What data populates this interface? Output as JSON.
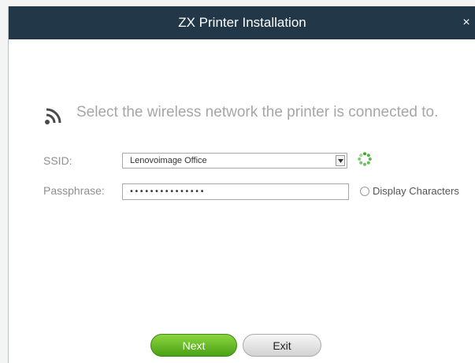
{
  "window": {
    "title": "ZX Printer Installation",
    "close_symbol": "×"
  },
  "content": {
    "heading": "Select the wireless network the printer is connected to.",
    "heading_icon": "wifi-icon",
    "ssid": {
      "label": "SSID:",
      "value": "Lenovoimage Office"
    },
    "passphrase": {
      "label": "Passphrase:",
      "value": "•••••••••••••••"
    },
    "display_characters": {
      "label": "Display Characters",
      "checked": false
    },
    "loading_icon": "spinner-icon"
  },
  "buttons": {
    "next": "Next",
    "exit": "Exit"
  },
  "colors": {
    "titlebar": "#223747",
    "next_button": "#5cb51f",
    "spinner": "#3fa830"
  }
}
